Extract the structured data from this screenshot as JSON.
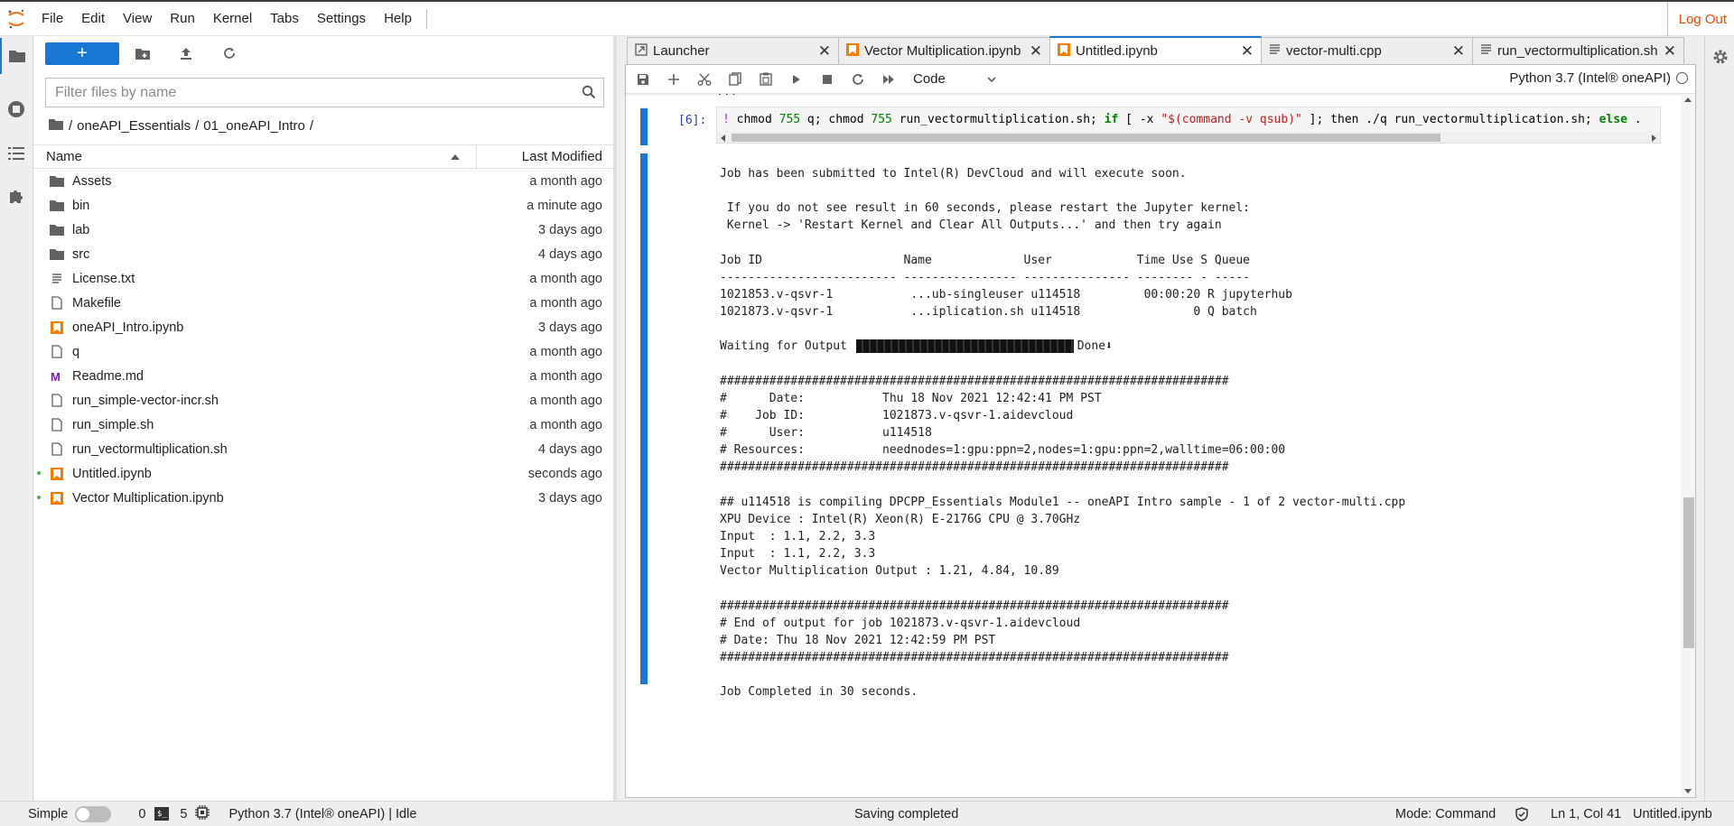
{
  "menu": {
    "items": [
      "File",
      "Edit",
      "View",
      "Run",
      "Kernel",
      "Tabs",
      "Settings",
      "Help"
    ],
    "logout": "Log Out"
  },
  "filebrowser": {
    "new_label": "+",
    "filter_placeholder": "Filter files by name",
    "breadcrumb": [
      "/",
      "oneAPI_Essentials",
      "/",
      "01_oneAPI_Intro",
      "/"
    ],
    "col_name": "Name",
    "col_modified": "Last Modified",
    "files": [
      {
        "name": "Assets",
        "type": "folder",
        "modified": "a month ago",
        "running": false
      },
      {
        "name": "bin",
        "type": "folder",
        "modified": "a minute ago",
        "running": false
      },
      {
        "name": "lab",
        "type": "folder",
        "modified": "3 days ago",
        "running": false
      },
      {
        "name": "src",
        "type": "folder",
        "modified": "4 days ago",
        "running": false
      },
      {
        "name": "License.txt",
        "type": "text",
        "modified": "a month ago",
        "running": false
      },
      {
        "name": "Makefile",
        "type": "file",
        "modified": "a month ago",
        "running": false
      },
      {
        "name": "oneAPI_Intro.ipynb",
        "type": "notebook",
        "modified": "3 days ago",
        "running": false
      },
      {
        "name": "q",
        "type": "file",
        "modified": "a month ago",
        "running": false
      },
      {
        "name": "Readme.md",
        "type": "markdown",
        "modified": "a month ago",
        "running": false
      },
      {
        "name": "run_simple-vector-incr.sh",
        "type": "file",
        "modified": "a month ago",
        "running": false
      },
      {
        "name": "run_simple.sh",
        "type": "file",
        "modified": "a month ago",
        "running": false
      },
      {
        "name": "run_vectormultiplication.sh",
        "type": "file",
        "modified": "4 days ago",
        "running": false
      },
      {
        "name": "Untitled.ipynb",
        "type": "notebook",
        "modified": "seconds ago",
        "running": true
      },
      {
        "name": "Vector Multiplication.ipynb",
        "type": "notebook",
        "modified": "3 days ago",
        "running": true
      }
    ]
  },
  "tabs": [
    {
      "label": "Launcher",
      "icon": "launcher-icon",
      "active": false
    },
    {
      "label": "Vector Multiplication.ipynb",
      "icon": "notebook-icon",
      "active": false
    },
    {
      "label": "Untitled.ipynb",
      "icon": "notebook-icon",
      "active": true
    },
    {
      "label": "vector-multi.cpp",
      "icon": "text-file-icon",
      "active": false
    },
    {
      "label": "run_vectormultiplication.sh",
      "icon": "text-file-icon",
      "active": false
    }
  ],
  "notebook": {
    "cell_type": "Code",
    "kernel": "Python 3.7 (Intel® oneAPI)",
    "prev_output_fragment": "                                    ...",
    "prompt": "[6]:",
    "code": {
      "bang": "!",
      "p1": " chmod ",
      "n1": "755",
      "p2": " q; chmod ",
      "n2": "755",
      "p3": " run_vectormultiplication.sh; ",
      "k1": "if",
      "p4": " [ -x ",
      "s1": "\"$(command -v qsub)\"",
      "p5": " ]; then ./q run_vectormultiplication.sh; ",
      "k2": "else",
      "p6": " ."
    },
    "output": {
      "l01": "Job has been submitted to Intel(R) DevCloud and will execute soon.",
      "l02": "",
      "l03": " If you do not see result in 60 seconds, please restart the Jupyter kernel:",
      "l04": " Kernel -> 'Restart Kernel and Clear All Outputs...' and then try again",
      "l05": "",
      "l06": "Job ID                    Name             User            Time Use S Queue",
      "l07": "------------------------- ---------------- --------------- -------- - -----",
      "l08": "1021853.v-qsvr-1           ...ub-singleuser u114518         00:00:20 R jupyterhub",
      "l09": "1021873.v-qsvr-1           ...iplication.sh u114518                0 Q batch",
      "l10": "",
      "l11_a": "Waiting for Output ",
      "l11_b": "Done⬇",
      "l12": "",
      "l13": "########################################################################",
      "l14": "#      Date:           Thu 18 Nov 2021 12:42:41 PM PST",
      "l15": "#    Job ID:           1021873.v-qsvr-1.aidevcloud",
      "l16": "#      User:           u114518",
      "l17": "# Resources:           neednodes=1:gpu:ppn=2,nodes=1:gpu:ppn=2,walltime=06:00:00",
      "l18": "########################################################################",
      "l19": "",
      "l20": "## u114518 is compiling DPCPP_Essentials Module1 -- oneAPI Intro sample - 1 of 2 vector-multi.cpp",
      "l21": "XPU Device : Intel(R) Xeon(R) E-2176G CPU @ 3.70GHz",
      "l22": "Input  : 1.1, 2.2, 3.3",
      "l23": "Input  : 1.1, 2.2, 3.3",
      "l24": "Vector Multiplication Output : 1.21, 4.84, 10.89",
      "l25": "",
      "l26": "########################################################################",
      "l27": "# End of output for job 1021873.v-qsvr-1.aidevcloud",
      "l28": "# Date: Thu 18 Nov 2021 12:42:59 PM PST",
      "l29": "########################################################################",
      "l30": "",
      "l31": "Job Completed in 30 seconds."
    },
    "progress": 1.0
  },
  "statusbar": {
    "simple": "Simple",
    "terminals": "0",
    "kernels": "5",
    "kernel_status": "Python 3.7 (Intel® oneAPI) | Idle",
    "message": "Saving completed",
    "mode": "Mode: Command",
    "position": "Ln 1, Col 41",
    "filename": "Untitled.ipynb"
  },
  "colors": {
    "accent": "#1976d2",
    "logout": "#e65100",
    "notebook_icon": "#f57c00",
    "markdown_icon": "#7b1fa2"
  }
}
